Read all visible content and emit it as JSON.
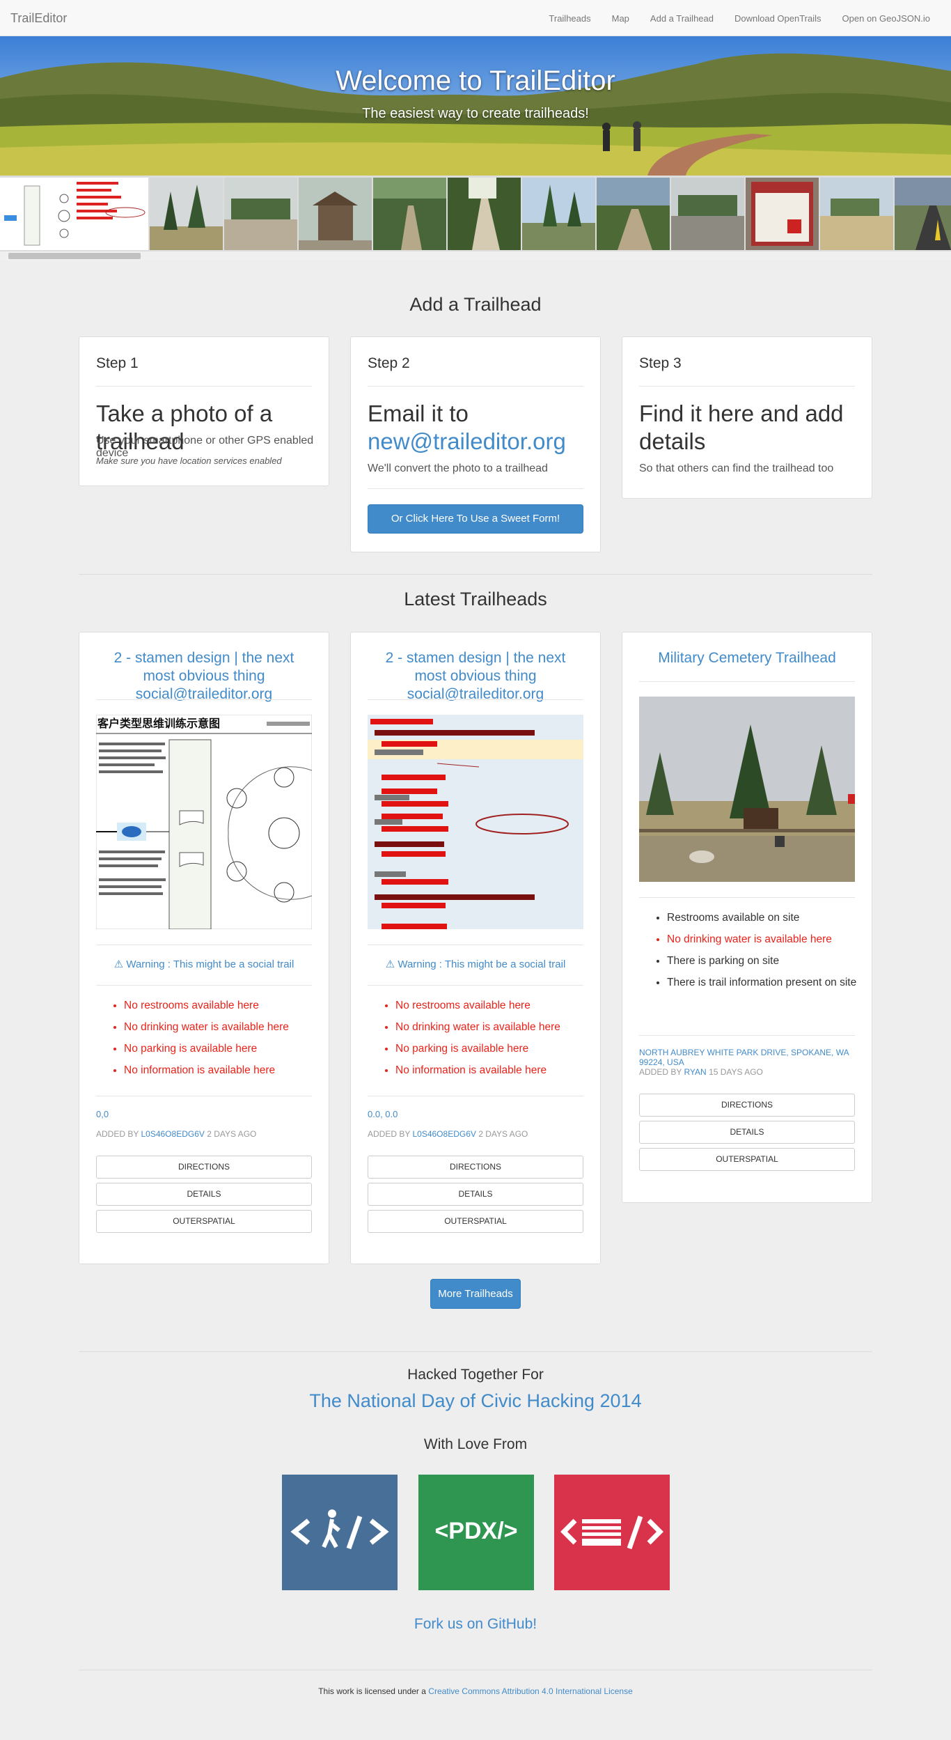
{
  "nav": {
    "brand": "TrailEditor",
    "links": [
      "Trailheads",
      "Map",
      "Add a Trailhead",
      "Download OpenTrails",
      "Open on GeoJSON.io"
    ]
  },
  "hero": {
    "title": "Welcome to TrailEditor",
    "subtitle": "The easiest way to create trailheads!"
  },
  "add_section": {
    "title": "Add a Trailhead",
    "steps": [
      {
        "label": "Step 1",
        "title": "Take a photo of a trailhead",
        "desc": "Use your smartphone or other GPS enabled device",
        "note": "Make sure you have location services enabled"
      },
      {
        "label": "Step 2",
        "title_prefix": "Email it to",
        "email": "new@traileditor.org",
        "desc": "We'll convert the photo to a trailhead",
        "button": "Or Click Here To Use a Sweet Form!"
      },
      {
        "label": "Step 3",
        "title": "Find it here and add details",
        "desc": "So that others can find the trailhead too"
      }
    ]
  },
  "latest": {
    "title": "Latest Trailheads",
    "cards": [
      {
        "title": "2 - stamen design | the next most obvious thing social@traileditor.org",
        "warning": "Warning : This might be a social trail",
        "amenities": [
          "No restrooms available here",
          "No drinking water is available here",
          "No parking is available here",
          "No information is available here"
        ],
        "coords": "0,0",
        "added_prefix": "ADDED BY",
        "added_by": "L0S46O8EDG6V",
        "added_when": "2 DAYS AGO",
        "image_heading": "客户类型思维训练示意图"
      },
      {
        "title": "2 - stamen design | the next most obvious thing social@traileditor.org",
        "warning": "Warning : This might be a social trail",
        "amenities": [
          "No restrooms available here",
          "No drinking water is available here",
          "No parking is available here",
          "No information is available here"
        ],
        "coords": "0.0, 0.0",
        "added_prefix": "ADDED BY",
        "added_by": "L0S46O8EDG6V",
        "added_when": "2 DAYS AGO"
      },
      {
        "title": "Military Cemetery Trailhead",
        "amenities": [
          "Restrooms available on site",
          "No drinking water is available here",
          "There is parking on site",
          "There is trail information present on site"
        ],
        "address": "NORTH AUBREY WHITE PARK DRIVE, SPOKANE, WA 99224, USA",
        "added_prefix": "ADDED BY",
        "added_by": "RYAN",
        "added_when": "15 DAYS AGO"
      }
    ],
    "buttons": [
      "DIRECTIONS",
      "DETAILS",
      "OUTERSPATIAL"
    ],
    "more_button": "More Trailheads"
  },
  "footer": {
    "hacked": "Hacked Together For",
    "event": "The National Day of Civic Hacking 2014",
    "love": "With Love From",
    "logo_pdx": "<PDX/>",
    "fork": "Fork us on GitHub!",
    "license_prefix": "This work is licensed under a",
    "license_link": "Creative Commons Attribution 4.0 International License"
  },
  "colors": {
    "link": "#428bca",
    "negative": "#e8231a",
    "logo_blue": "#486f98",
    "logo_green": "#2e9650",
    "logo_red": "#d8334a"
  }
}
